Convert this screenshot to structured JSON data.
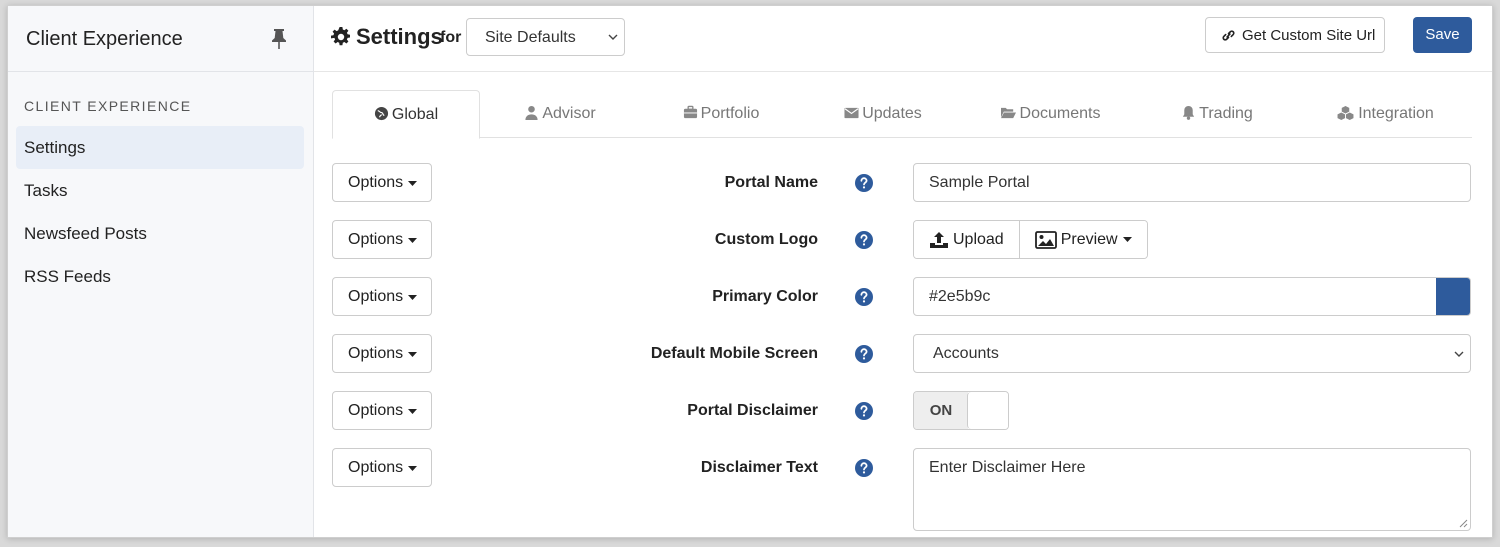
{
  "sidebar": {
    "title": "Client Experience",
    "section_label": "CLIENT EXPERIENCE",
    "items": [
      {
        "label": "Settings",
        "active": true
      },
      {
        "label": "Tasks",
        "active": false
      },
      {
        "label": "Newsfeed Posts",
        "active": false
      },
      {
        "label": "RSS Feeds",
        "active": false
      }
    ]
  },
  "header": {
    "title": "Settings",
    "for_label": "for",
    "site_select_value": "Site Defaults",
    "custom_url_label": "Get Custom Site Url",
    "save_label": "Save"
  },
  "tabs": [
    {
      "label": "Global",
      "icon": "globe-icon",
      "active": true
    },
    {
      "label": "Advisor",
      "icon": "user-icon",
      "active": false
    },
    {
      "label": "Portfolio",
      "icon": "briefcase-icon",
      "active": false
    },
    {
      "label": "Updates",
      "icon": "envelope-icon",
      "active": false
    },
    {
      "label": "Documents",
      "icon": "folder-open-icon",
      "active": false
    },
    {
      "label": "Trading",
      "icon": "bell-icon",
      "active": false
    },
    {
      "label": "Integration",
      "icon": "cubes-icon",
      "active": false
    }
  ],
  "options_label": "Options",
  "fields": {
    "portal_name": {
      "label": "Portal Name",
      "value": "Sample Portal"
    },
    "custom_logo": {
      "label": "Custom Logo",
      "upload_label": "Upload",
      "preview_label": "Preview"
    },
    "primary_color": {
      "label": "Primary Color",
      "value": "#2e5b9c"
    },
    "default_mobile_screen": {
      "label": "Default Mobile Screen",
      "value": "Accounts"
    },
    "portal_disclaimer": {
      "label": "Portal Disclaimer",
      "toggle_label": "ON"
    },
    "disclaimer_text": {
      "label": "Disclaimer Text",
      "placeholder": "Enter Disclaimer Here"
    }
  },
  "colors": {
    "accent": "#2e5b9c",
    "active_nav_bg": "#e8eef7"
  }
}
